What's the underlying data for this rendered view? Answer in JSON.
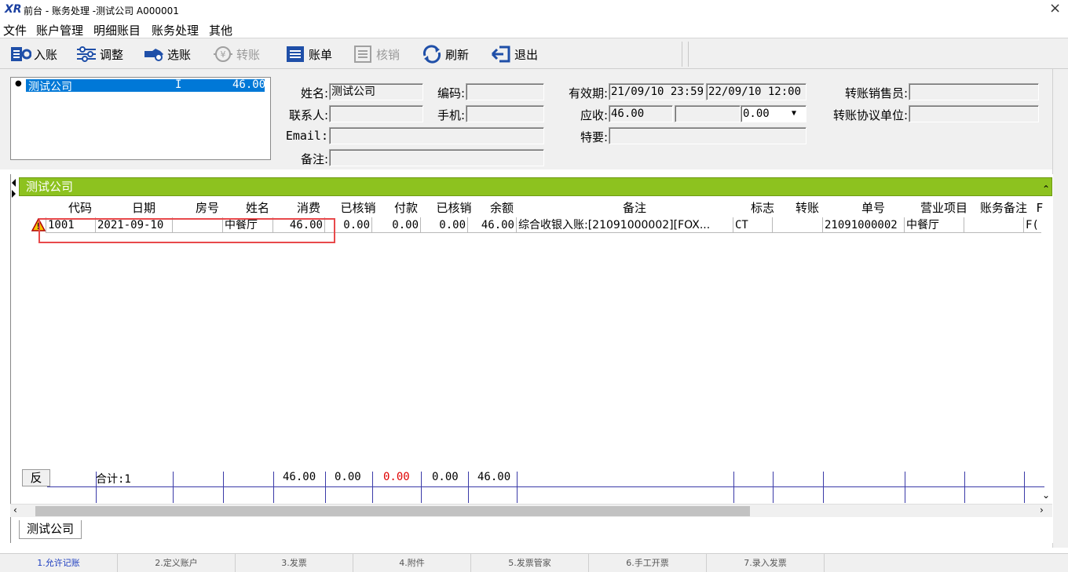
{
  "window": {
    "logo": "XR",
    "title": "前台 - 账务处理 -测试公司  A000001",
    "close": "×"
  },
  "menu": [
    "文件",
    "账户管理",
    "明细账目",
    "账务处理",
    "其他"
  ],
  "toolbar": [
    {
      "label": "入账",
      "icon": "post-entry-icon"
    },
    {
      "label": "调整",
      "icon": "adjust-sliders-icon"
    },
    {
      "label": "选账",
      "icon": "select-account-icon"
    },
    {
      "label": "转账",
      "icon": "yen-transfer-icon",
      "disabled": true
    },
    {
      "label": "账单",
      "icon": "bill-list-icon"
    },
    {
      "label": "核销",
      "icon": "writeoff-list-icon",
      "disabled": true
    },
    {
      "label": "刷新",
      "icon": "refresh-icon"
    },
    {
      "label": "退出",
      "icon": "exit-arrow-icon"
    }
  ],
  "account_list": {
    "rows": [
      {
        "name": "测试公司",
        "type": "I",
        "amount": "46.00"
      }
    ]
  },
  "form": {
    "name_label": "姓名:",
    "name_value": "测试公司",
    "code_label": "编码:",
    "code_value": "",
    "contact_label": "联系人:",
    "contact_value": "",
    "phone_label": "手机:",
    "phone_value": "",
    "email_label": "Email:",
    "email_value": "",
    "remark_label": "备注:",
    "remark_value": "",
    "validity_label": "有效期:",
    "valid_from": "21/09/10 23:59",
    "valid_to": "22/09/10 12:00",
    "receivable_label": "应收:",
    "receivable_value": "46.00",
    "receivable_mid": "",
    "receivable_select": "0.00",
    "special_label": "特要:",
    "special_value": "",
    "salesperson_label": "转账销售员:",
    "salesperson_value": "",
    "agreement_label": "转账协议单位:",
    "agreement_value": ""
  },
  "grid": {
    "group_title": "测试公司",
    "columns": [
      "代码",
      "日期",
      "房号",
      "姓名",
      "消费",
      "已核销",
      "付款",
      "已核销",
      "余额",
      "备注",
      "标志",
      "转账",
      "单号",
      "营业项目",
      "账务备注",
      "F"
    ],
    "rows": [
      {
        "code": "1001",
        "date": "2021-09-10",
        "room": "",
        "name": "中餐厅",
        "consume": "46.00",
        "verified1": "0.00",
        "payment": "0.00",
        "verified2": "0.00",
        "balance": "46.00",
        "remark": "综合收银入账:[21091000002][FOX...",
        "flag": "CT",
        "transfer": "",
        "bill_no": "21091000002",
        "business": "中餐厅",
        "acct_remark": "",
        "extra": "F("
      }
    ],
    "totals": {
      "reverse": "反",
      "count": "合计:1",
      "consume": "46.00",
      "verified1": "0.00",
      "payment": "0.00",
      "verified2": "0.00",
      "balance": "46.00"
    }
  },
  "bottom_tab": "测试公司",
  "statusbar": [
    "1.允许记账",
    "2.定义账户",
    "3.发票",
    "4.附件",
    "5.发票管家",
    "6.手工开票",
    "7.录入发票"
  ],
  "colors": {
    "group_bar": "#8dc21f",
    "selection": "#0078d7",
    "highlight": "#e8494b",
    "negative": "#e00000"
  }
}
